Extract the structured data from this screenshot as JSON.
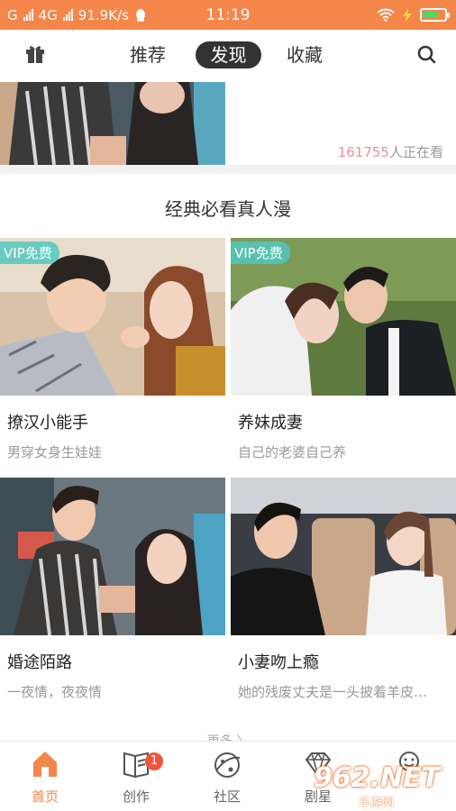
{
  "status_bar": {
    "carrier": "G",
    "network": "4G",
    "speed": "91.9K/s",
    "time": "11:19"
  },
  "top_nav": {
    "tabs": [
      {
        "label": "推荐",
        "active": false
      },
      {
        "label": "发现",
        "active": true
      },
      {
        "label": "收藏",
        "active": false
      }
    ],
    "left_icon": "gift-icon",
    "right_icon": "search-icon"
  },
  "banner": {
    "viewer_count": "161755",
    "viewer_suffix": "人正在看"
  },
  "section": {
    "title": "经典必看真人漫"
  },
  "cards": [
    {
      "badge": "VIP免费",
      "title": "撩汉小能手",
      "desc": "男穿女身生娃娃"
    },
    {
      "badge": "VIP免费",
      "title": "养妹成妻",
      "desc": "自己的老婆自己养"
    },
    {
      "badge": "",
      "title": "婚途陌路",
      "desc": "一夜情，夜夜情"
    },
    {
      "badge": "",
      "title": "小妻吻上瘾",
      "desc": "她的残废丈夫是一头披着羊皮…"
    }
  ],
  "more_label": "更多 〉",
  "bottom_nav": [
    {
      "label": "首页",
      "icon": "home-icon",
      "active": true
    },
    {
      "label": "创作",
      "icon": "book-icon",
      "active": false,
      "badge": "1"
    },
    {
      "label": "社区",
      "icon": "planet-icon",
      "active": false
    },
    {
      "label": "剧星",
      "icon": "diamond-icon",
      "active": false
    },
    {
      "label": "",
      "icon": "profile-icon",
      "active": false
    }
  ],
  "watermark": {
    "logo": "962.NET",
    "sub": "乐游网"
  },
  "colors": {
    "accent": "#f5864a",
    "vip_badge": "#50c8be",
    "notification": "#f0553c"
  }
}
